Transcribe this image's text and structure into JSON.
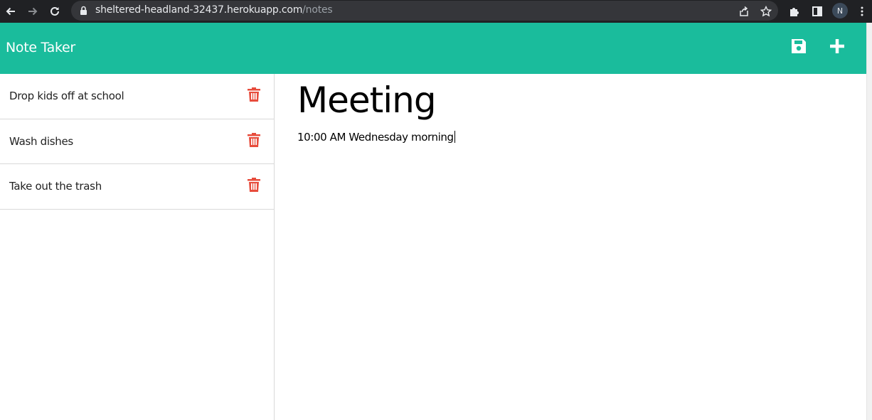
{
  "browser": {
    "url_host": "sheltered-headland-32437.herokuapp.com",
    "url_path": "/notes",
    "profile_initial": "N"
  },
  "app": {
    "title": "Note Taker",
    "accent_color": "#1abc9c",
    "delete_color": "#e74c3c"
  },
  "notes": [
    {
      "title": "Drop kids off at school"
    },
    {
      "title": "Wash dishes"
    },
    {
      "title": "Take out the trash"
    }
  ],
  "active_note": {
    "title": "Meeting",
    "text": "10:00 AM Wednesday morning"
  },
  "icons": {
    "save": "floppy-disk-icon",
    "new": "plus-icon",
    "delete": "trash-icon"
  }
}
